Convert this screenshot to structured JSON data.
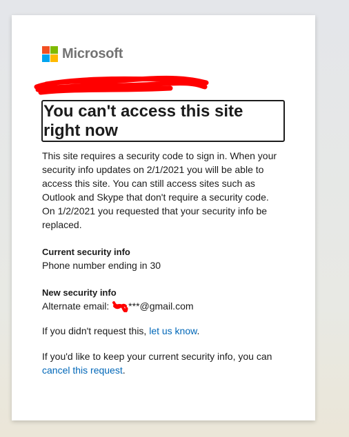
{
  "brand": {
    "name": "Microsoft",
    "logo_colors": [
      "#f25022",
      "#7fba00",
      "#00a4ef",
      "#ffb900"
    ]
  },
  "redaction_color": "#ff0000",
  "heading": "You can't access this site right now",
  "description": {
    "line1": "This site requires a security code to sign in. When your security info updates on 2/1/2021 you will be able to access this site. You can still access sites such as Outlook and Skype that don't require a security code.",
    "line2": "On 1/2/2021 you requested that your security info be replaced."
  },
  "current_info": {
    "label": "Current security info",
    "value": "Phone number ending in 30"
  },
  "new_info": {
    "label": "New security info",
    "prefix": "Alternate email: ",
    "value_suffix": "***@gmail.com"
  },
  "not_requested": {
    "text": "If you didn't request this, ",
    "link": "let us know",
    "end": "."
  },
  "keep_current": {
    "text": "If you'd like to keep your current security info, you can ",
    "link": "cancel this request",
    "end": "."
  }
}
